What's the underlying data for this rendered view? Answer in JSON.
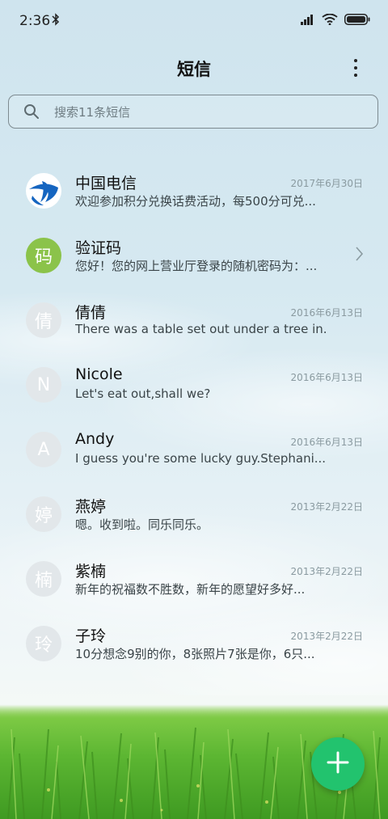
{
  "status_bar": {
    "time": "2:36",
    "icons": [
      "bluetooth-icon",
      "signal-icon",
      "wifi-icon",
      "battery-icon"
    ]
  },
  "header": {
    "title": "短信",
    "more_icon": "more-vert-icon"
  },
  "search": {
    "placeholder": "搜索11条短信",
    "icon": "search-icon"
  },
  "conversations": [
    {
      "name": "中国电信",
      "date": "2017年6月30日",
      "preview": "欢迎参加积分兑换话费活动，每500分可兑...",
      "avatar": "",
      "avatar_type": "logo"
    },
    {
      "name": "验证码",
      "date": "",
      "preview": "您好！您的网上营业厅登录的随机密码为：...",
      "avatar": "码",
      "avatar_type": "green"
    },
    {
      "name": "倩倩",
      "date": "2016年6月13日",
      "preview": "There was a table set out under a tree in...",
      "avatar": "倩",
      "avatar_type": "grey"
    },
    {
      "name": "Nicole",
      "date": "2016年6月13日",
      "preview": "Let's eat out,shall we?",
      "avatar": "N",
      "avatar_type": "grey"
    },
    {
      "name": "Andy",
      "date": "2016年6月13日",
      "preview": "I guess you're some lucky guy.Stephani...",
      "avatar": "A",
      "avatar_type": "grey"
    },
    {
      "name": "燕婷",
      "date": "2013年2月22日",
      "preview": "嗯。收到啦。同乐同乐。",
      "avatar": "婷",
      "avatar_type": "grey"
    },
    {
      "name": "紫楠",
      "date": "2013年2月22日",
      "preview": "新年的祝福数不胜数，新年的愿望好多好...",
      "avatar": "楠",
      "avatar_type": "grey"
    },
    {
      "name": "子玲",
      "date": "2013年2月22日",
      "preview": "10分想念9别的你，8张照片7张是你，6只...",
      "avatar": "玲",
      "avatar_type": "grey"
    }
  ],
  "fab": {
    "icon": "plus-icon",
    "color": "#22c36e"
  },
  "colors": {
    "fab": "#22c36e",
    "verification_avatar": "#8bc34a",
    "telecom_blue": "#1565c0"
  }
}
